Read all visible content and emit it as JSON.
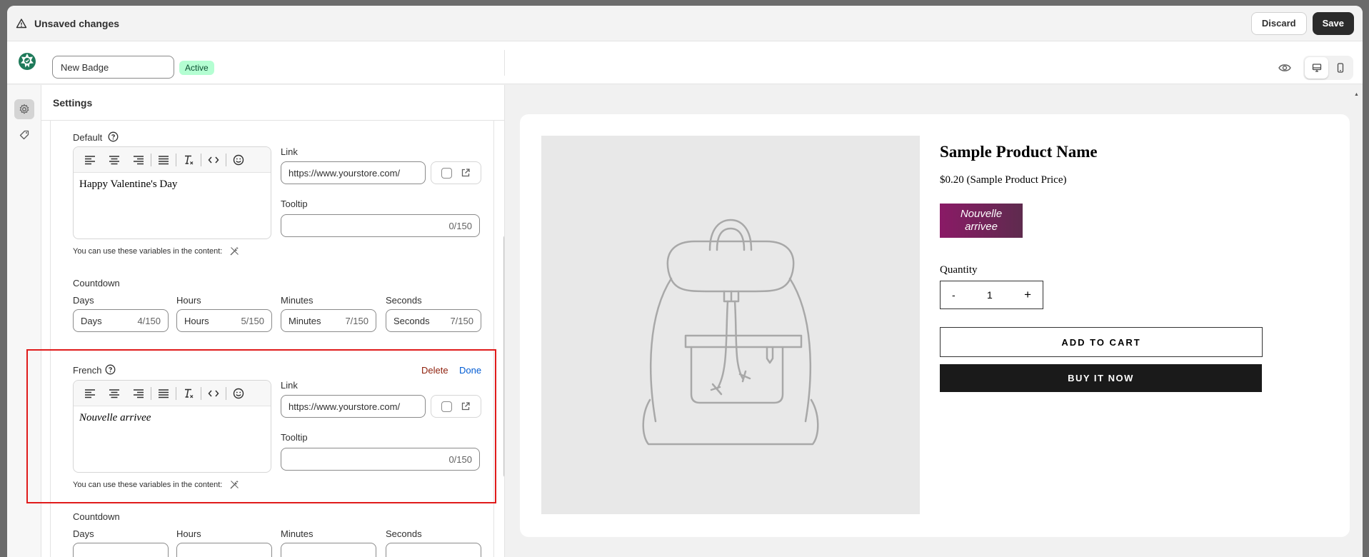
{
  "topbar": {
    "title": "Unsaved changes",
    "discard_label": "Discard",
    "save_label": "Save"
  },
  "header": {
    "badge_name_value": "New Badge",
    "status_badge": "Active"
  },
  "panel": {
    "title": "Settings"
  },
  "default_lang": {
    "label": "Default",
    "content": "Happy Valentine's Day",
    "link_label": "Link",
    "link_placeholder": "https://www.yourstore.com/",
    "tooltip_label": "Tooltip",
    "tooltip_counter": "0/150",
    "variables_note": "You can use these variables in the content:"
  },
  "countdown1": {
    "title": "Countdown",
    "fields": [
      {
        "label": "Days",
        "value": "Days",
        "counter": "4/150"
      },
      {
        "label": "Hours",
        "value": "Hours",
        "counter": "5/150"
      },
      {
        "label": "Minutes",
        "value": "Minutes",
        "counter": "7/150"
      },
      {
        "label": "Seconds",
        "value": "Seconds",
        "counter": "7/150"
      }
    ]
  },
  "french_lang": {
    "label": "French",
    "delete_label": "Delete",
    "done_label": "Done",
    "content": "Nouvelle arrivee",
    "link_label": "Link",
    "link_placeholder": "https://www.yourstore.com/",
    "tooltip_label": "Tooltip",
    "tooltip_counter": "0/150",
    "variables_note": "You can use these variables in the content:"
  },
  "countdown2": {
    "title": "Countdown",
    "fields": [
      {
        "label": "Days"
      },
      {
        "label": "Hours"
      },
      {
        "label": "Minutes"
      },
      {
        "label": "Seconds"
      }
    ]
  },
  "preview": {
    "product_name": "Sample Product Name",
    "price": "$0.20 (Sample Product Price)",
    "badge_text": "Nouvelle arrivee",
    "quantity_label": "Quantity",
    "qty_minus": "-",
    "qty_value": "1",
    "qty_plus": "+",
    "add_to_cart": "ADD TO CART",
    "buy_now": "BUY IT NOW"
  },
  "colors": {
    "badge_bg_start": "#8a1a66",
    "badge_bg_end": "#5e2b4e",
    "active_badge": "#b4fed2",
    "highlight_border": "#e01b1b"
  }
}
